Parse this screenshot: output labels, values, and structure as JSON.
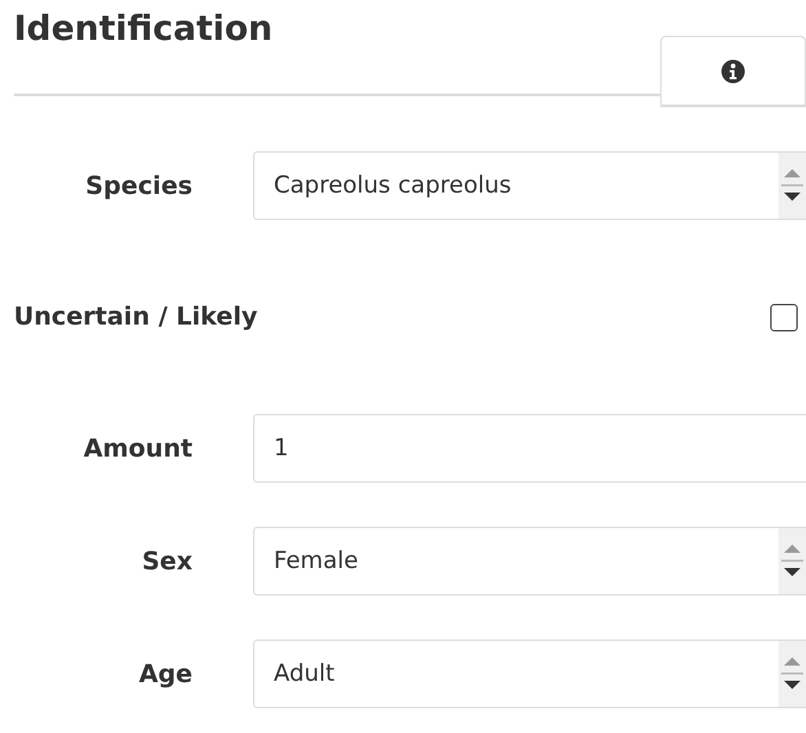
{
  "heading": "Identification",
  "info_tab": {
    "selected": false
  },
  "fields": [
    {
      "kind": "select",
      "label": "Species",
      "value": "Capreolus capreolus"
    },
    {
      "kind": "checkbox",
      "label": "Uncertain / Likely",
      "checked": false
    },
    {
      "kind": "text",
      "label": "Amount",
      "value": "1"
    },
    {
      "kind": "select",
      "label": "Sex",
      "value": "Female"
    },
    {
      "kind": "select",
      "label": "Age",
      "value": "Adult"
    }
  ]
}
